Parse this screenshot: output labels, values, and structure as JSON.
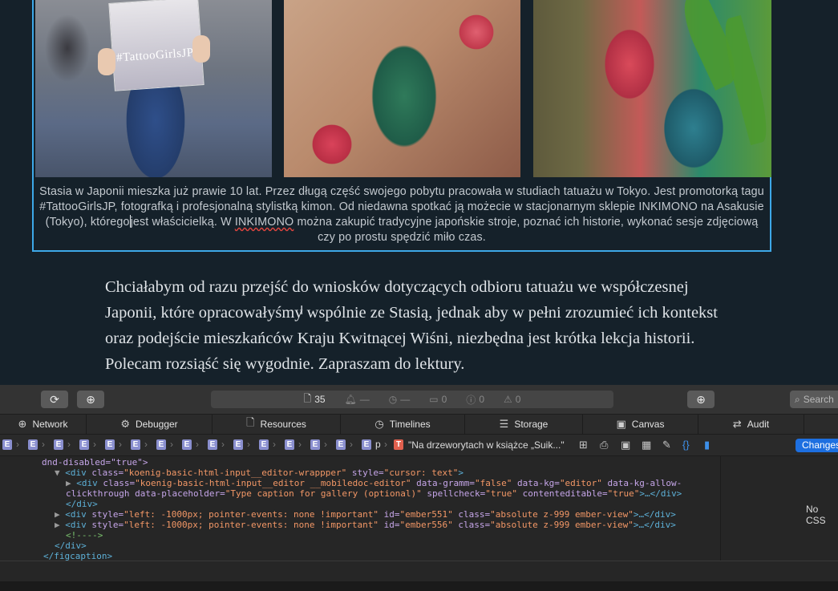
{
  "gallery": {
    "photo_1_label": "#TattooGirlsJP",
    "caption_part1": "Stasia w Japonii mieszka już prawie 10 lat. Przez długą część swojego pobytu pracowała w studiach tatuażu w Tokyo. Jest promotorką tagu #TattooGirlsJP, fotografką i profesjonalną stylistką kimon. Od niedawna spotkać ją możecie w stacjonarnym sklepie INKIMONO na Asakusie (Tokyo), którego",
    "caption_part2": "jest właścicielką. W ",
    "caption_underlined": "INKIMONO",
    "caption_part3": " można zakupić tradycyjne japońskie stroje, poznać ich historie, wykonać sesje zdjęciową czy po prostu spędzić miło czas."
  },
  "article": {
    "paragraph": "Chciałabym od razu przejść do wniosków dotyczących odbioru tatuażu we współczesnej Japonii, które opracowałyśmy wspólnie ze Stasią, jednak aby w pełni zrozumieć ich kontekst oraz podejście mieszkańców Kraju Kwitnącej Wiśni, niezbędna jest krótka lekcja historii. Polecam rozsiąść się wygodnie.  Zapraszam do lektury."
  },
  "devtools": {
    "toolbar": {
      "resources_count": "35",
      "errors_count": "0",
      "warnings_count": "0",
      "logs_count": "0",
      "dash_1": "—",
      "dash_2": "—",
      "search_placeholder": "Search"
    },
    "tabs": [
      {
        "label": "Network",
        "icon": "network-icon"
      },
      {
        "label": "Debugger",
        "icon": "debugger-icon"
      },
      {
        "label": "Resources",
        "icon": "resources-icon"
      },
      {
        "label": "Timelines",
        "icon": "timelines-icon"
      },
      {
        "label": "Storage",
        "icon": "storage-icon"
      },
      {
        "label": "Canvas",
        "icon": "canvas-icon"
      },
      {
        "label": "Audit",
        "icon": "audit-icon"
      }
    ],
    "breadcrumb": {
      "element_badge": "E",
      "p_label": "p",
      "text_badge": "T",
      "text_node": "\"Na drzeworytach w książce „Suik...\""
    },
    "changes_label": "Changes",
    "no_css": "No CSS",
    "dom_lines": {
      "l1_text": "dnd-disabled=\"true\">",
      "l2_tag": "<div",
      "l2_attr1": " class=",
      "l2_val1": "\"koenig-basic-html-input__editor-wrappper\"",
      "l2_attr2": " style=",
      "l2_val2": "\"cursor: text\"",
      "l2_end": ">",
      "l3_tag": "<div",
      "l3_attr1": " class=",
      "l3_val1": "\"koenig-basic-html-input__editor __mobiledoc-editor\"",
      "l3_attr2": " data-gramm=",
      "l3_val2": "\"false\"",
      "l3_attr3": " data-kg=",
      "l3_val3": "\"editor\"",
      "l3_attr4": " data-kg-allow-",
      "l4_attr1": "clickthrough",
      "l4_attr2": " data-placeholder=",
      "l4_val2": "\"Type caption for gallery (optional)\"",
      "l4_attr3": " spellcheck=",
      "l4_val3": "\"true\"",
      "l4_attr4": " contenteditable=",
      "l4_val4": "\"true\"",
      "l4_end": ">…</div>",
      "l5_text": "</div>",
      "l6_tag": "<div",
      "l6_attr1": " style=",
      "l6_val1": "\"left: -1000px; pointer-events: none !important\"",
      "l6_attr2": " id=",
      "l6_val2": "\"ember551\"",
      "l6_attr3": " class=",
      "l6_val3": "\"absolute z-999 ember-view\"",
      "l6_end": ">…</div>",
      "l7_tag": "<div",
      "l7_attr1": " style=",
      "l7_val1": "\"left: -1000px; pointer-events: none !important\"",
      "l7_attr2": " id=",
      "l7_val2": "\"ember556\"",
      "l7_attr3": " class=",
      "l7_val3": "\"absolute z-999 ember-view\"",
      "l7_end": ">…</div>",
      "l8_text": "<!---->",
      "l9_text": "</div>",
      "l10_text": "</figcaption>"
    }
  },
  "colors": {
    "selection_border": "#3da8e8",
    "page_bg": "#15212a",
    "devtools_accent": "#1d6fe0"
  }
}
